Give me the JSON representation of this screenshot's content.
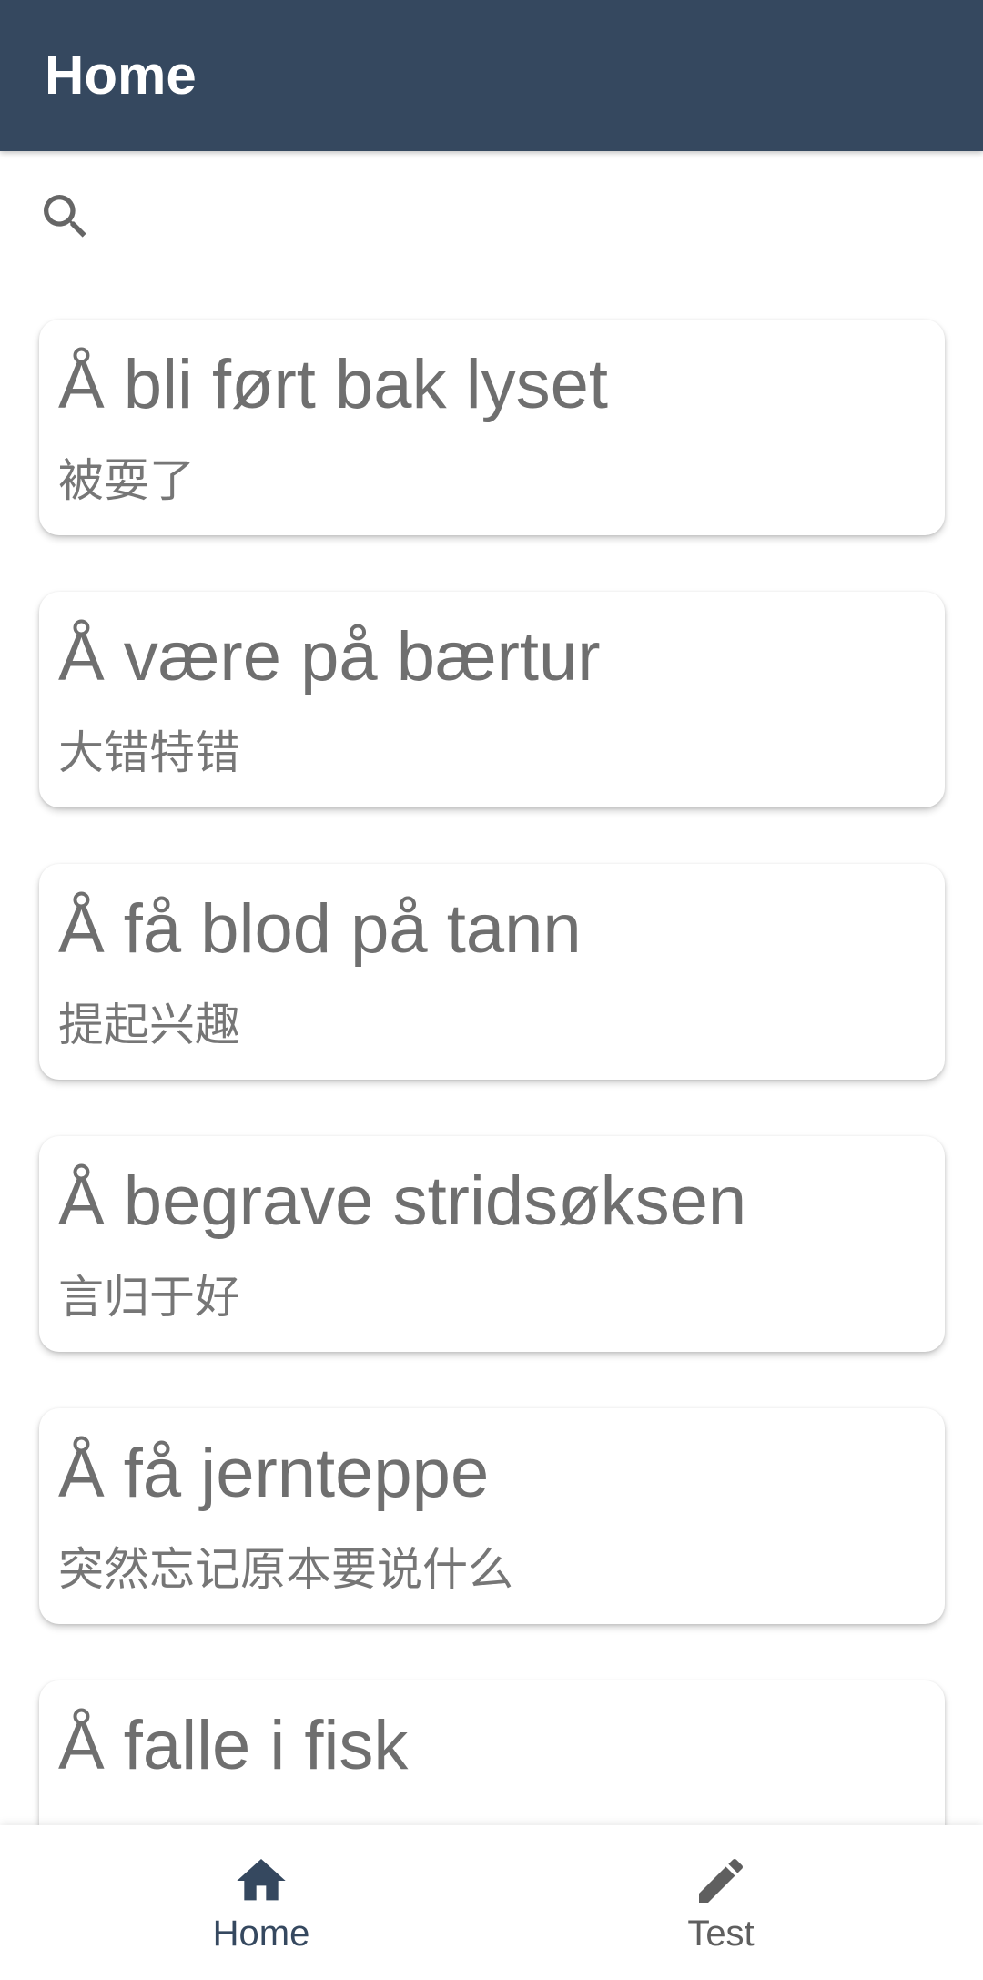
{
  "header": {
    "title": "Home",
    "background_color": "#35485f"
  },
  "search": {
    "icon": "search-icon",
    "value": "",
    "placeholder": ""
  },
  "phrases": [
    {
      "title": "Å bli ført bak lyset",
      "translation": "被耍了"
    },
    {
      "title": "Å være på bærtur",
      "translation": "大错特错"
    },
    {
      "title": "Å få blod på tann",
      "translation": "提起兴趣"
    },
    {
      "title": "Å begrave stridsøksen",
      "translation": "言归于好"
    },
    {
      "title": "Å få jernteppe",
      "translation": "突然忘记原本要说什么"
    },
    {
      "title": "Å falle i fisk",
      "translation": ""
    }
  ],
  "bottom_nav": {
    "items": [
      {
        "label": "Home",
        "icon": "home-icon",
        "active": true,
        "color": "#35485f"
      },
      {
        "label": "Test",
        "icon": "pencil-icon",
        "active": false,
        "color": "#5f5f5f"
      }
    ]
  }
}
